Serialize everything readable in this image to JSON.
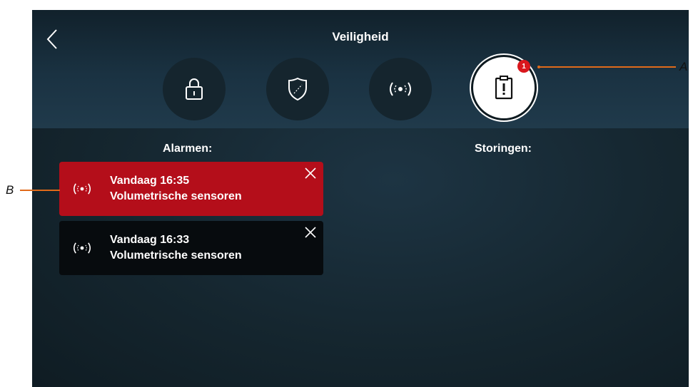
{
  "header": {
    "title": "Veiligheid"
  },
  "categories": [
    {
      "icon": "lock-icon",
      "label": ""
    },
    {
      "icon": "shield-icon",
      "label": ""
    },
    {
      "icon": "sensor-icon",
      "label": ""
    },
    {
      "icon": "clipboard-alert-icon",
      "badge": "1"
    }
  ],
  "columns": {
    "alarms": "Alarmen:",
    "faults": "Storingen:"
  },
  "alarms": [
    {
      "time": "Vandaag 16:35",
      "name": "Volumetrische sensoren",
      "color": "#b40e1a"
    },
    {
      "time": "Vandaag 16:33",
      "name": "Volumetrische sensoren",
      "color": "#070b0e"
    }
  ],
  "callouts": {
    "a": "A",
    "b": "B"
  },
  "colors": {
    "accent_line": "#e06a1a",
    "badge": "#d9171d"
  }
}
